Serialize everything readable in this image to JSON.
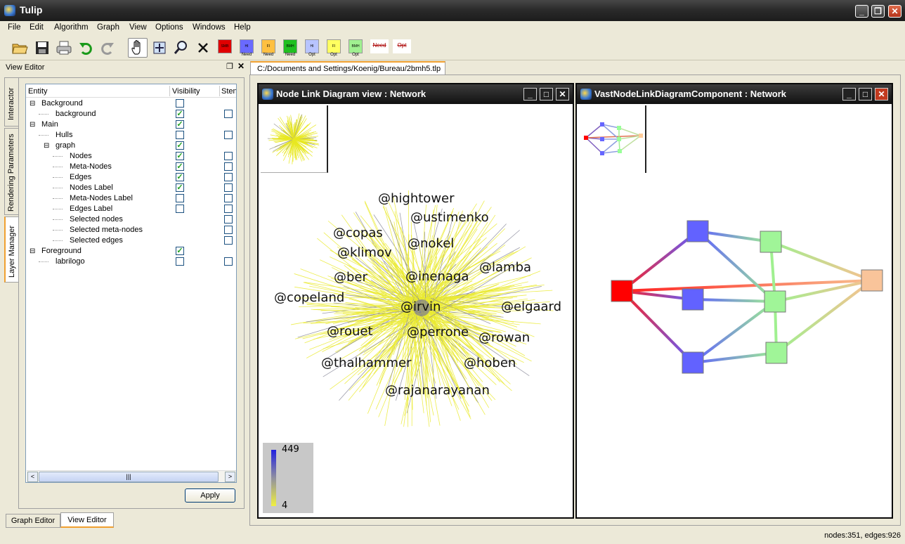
{
  "app": {
    "title": "Tulip"
  },
  "menus": [
    "File",
    "Edit",
    "Algorithm",
    "Graph",
    "View",
    "Options",
    "Windows",
    "Help"
  ],
  "toolbar": {
    "chips": [
      {
        "label": "SMB",
        "sub": "",
        "color": "#e00000"
      },
      {
        "label": "HI",
        "sub": "Need",
        "color": "#6a6aff"
      },
      {
        "label": "FI",
        "sub": "Need",
        "color": "#ffc040"
      },
      {
        "label": "BMH",
        "sub": "Need",
        "color": "#20c020"
      },
      {
        "label": "HI",
        "sub": "Opt",
        "color": "#b8c4ff"
      },
      {
        "label": "FI",
        "sub": "Opt",
        "color": "#ffff60"
      },
      {
        "label": "BMH",
        "sub": "Opt",
        "color": "#a0f090"
      },
      {
        "label": "Need",
        "sub": "",
        "color": "#ffffff"
      },
      {
        "label": "Opt",
        "sub": "",
        "color": "#ffffff"
      }
    ]
  },
  "view_editor": {
    "title": "View Editor",
    "side_tabs": [
      "Interactor",
      "Rendering Parameters",
      "Layer Manager"
    ],
    "columns": [
      "Entity",
      "Visibility",
      "Stencil"
    ],
    "rows": [
      {
        "name": "Background",
        "level": 0,
        "expander": "⊟",
        "vis": false,
        "stencil": null
      },
      {
        "name": "background",
        "level": 1,
        "expander": "",
        "vis": true,
        "stencil": false
      },
      {
        "name": "Main",
        "level": 0,
        "expander": "⊟",
        "vis": true,
        "stencil": null
      },
      {
        "name": "Hulls",
        "level": 1,
        "expander": "",
        "vis": false,
        "stencil": false
      },
      {
        "name": "graph",
        "level": 1,
        "expander": "⊟",
        "vis": true,
        "stencil": null
      },
      {
        "name": "Nodes",
        "level": 2,
        "expander": "",
        "vis": true,
        "stencil": false
      },
      {
        "name": "Meta-Nodes",
        "level": 2,
        "expander": "",
        "vis": true,
        "stencil": false
      },
      {
        "name": "Edges",
        "level": 2,
        "expander": "",
        "vis": true,
        "stencil": false
      },
      {
        "name": "Nodes Label",
        "level": 2,
        "expander": "",
        "vis": true,
        "stencil": false
      },
      {
        "name": "Meta-Nodes Label",
        "level": 2,
        "expander": "",
        "vis": false,
        "stencil": false
      },
      {
        "name": "Edges Label",
        "level": 2,
        "expander": "",
        "vis": false,
        "stencil": false
      },
      {
        "name": "Selected nodes",
        "level": 2,
        "expander": "",
        "vis": null,
        "stencil": false
      },
      {
        "name": "Selected meta-nodes",
        "level": 2,
        "expander": "",
        "vis": null,
        "stencil": false
      },
      {
        "name": "Selected edges",
        "level": 2,
        "expander": "",
        "vis": null,
        "stencil": false
      },
      {
        "name": "Foreground",
        "level": 0,
        "expander": "⊟",
        "vis": true,
        "stencil": null
      },
      {
        "name": "labrilogo",
        "level": 1,
        "expander": "",
        "vis": false,
        "stencil": false
      }
    ],
    "apply_label": "Apply",
    "bottom_tabs": [
      "Graph Editor",
      "View Editor"
    ]
  },
  "document_tab": "C:/Documents and Settings/Koenig/Bureau/2bmh5.tlp",
  "view1": {
    "title": "Node Link Diagram view : Network",
    "labels": [
      "@hightower",
      "@ustimenko",
      "@copas",
      "@nokel",
      "@klimov",
      "@lamba",
      "@ber",
      "@inenaga",
      "@copeland",
      "@irvin",
      "@elgaard",
      "@rouet",
      "@perrone",
      "@rowan",
      "@thalhammer",
      "@hoben",
      "@rajanarayanan"
    ],
    "legend_max": "449",
    "legend_min": "4"
  },
  "view2": {
    "title": "VastNodeLinkDiagramComponent : Network"
  },
  "status": "nodes:351, edges:926"
}
